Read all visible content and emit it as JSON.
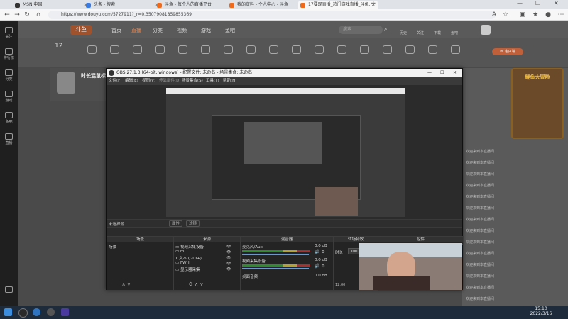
{
  "browser": {
    "tabs": [
      {
        "label": "MSN 中国"
      },
      {
        "label": "头条 - 搜索"
      },
      {
        "label": "斗鱼 - 每个人的直播平台"
      },
      {
        "label": "我的资料 - 个人中心 - 斗鱼"
      },
      {
        "label": "17要观直播_热门游戏直播_斗鱼..."
      }
    ],
    "url": "https://www.douyu.com/5727911?_r=0.35079081859855369"
  },
  "site": {
    "logo": "斗鱼",
    "nav": [
      "首页",
      "直播",
      "分类",
      "视频",
      "游戏",
      "鱼吧"
    ],
    "search_placeholder": "搜索",
    "user_links": [
      "历史",
      "关注",
      "下载",
      "鱼吧"
    ],
    "level": "12",
    "categories": [
      "",
      "",
      "",
      "",
      "",
      "",
      "",
      "",
      "",
      "",
      "",
      "",
      "",
      "",
      "",
      "",
      "",
      "",
      ""
    ],
    "pc_badge": "PC客户端",
    "streamer_name": "时长混鼠标",
    "side_badge": "鲤鱼大冒险",
    "sidebar_items": [
      "关注",
      "排行榜",
      "分类",
      "游戏",
      "鱼吧",
      "直播"
    ],
    "chat_lines": [
      "欢迎来到本直播间",
      "欢迎来到本直播间",
      "欢迎来到本直播间",
      "欢迎来到本直播间",
      "欢迎来到本直播间",
      "欢迎来到本直播间",
      "欢迎来到本直播间",
      "欢迎来到本直播间",
      "欢迎来到本直播间",
      "欢迎来到本直播间",
      "欢迎来到本直播间",
      "欢迎来到本直播间",
      "欢迎来到本直播间",
      "欢迎来到本直播间"
    ]
  },
  "obs": {
    "title": "OBS 27.1.3 (64-bit, windows) - 配置文件: 未命名 - 场景集合: 未命名",
    "menu": [
      "文件(F)",
      "编辑(E)",
      "视图(V)",
      "停靠部件(D)",
      "场景集合(S)",
      "工具(T)",
      "帮助(H)"
    ],
    "no_source": "未选择源",
    "props_button": "属性",
    "filters_button": "滤镜",
    "docks": {
      "scenes": "场景",
      "sources": "来源",
      "mixer": "混音器",
      "transitions": "转场特效",
      "controls": "控件"
    },
    "scene_items": [
      "场景"
    ],
    "source_items": [
      "视频采集设备",
      "m",
      "文本 (GDI+)",
      "FWH",
      "显示器采集"
    ],
    "mixer_items": [
      {
        "name": "麦克风/Aux",
        "db": "0.0 dB"
      },
      {
        "name": "视频采集设备",
        "db": "0.0 dB"
      },
      {
        "name": "桌面音频",
        "db": "0.0 dB"
      }
    ],
    "transition_label": "时长",
    "transition_value": "300 ms",
    "fps": "12.00"
  },
  "taskbar": {
    "time": "15:10",
    "date": "2022/3/16"
  }
}
